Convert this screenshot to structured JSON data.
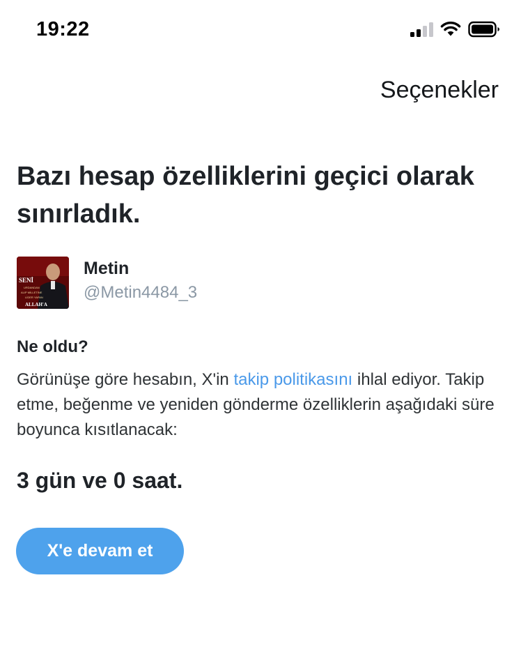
{
  "status_bar": {
    "time": "19:22",
    "icons": [
      "cellular-signal-icon",
      "wifi-icon",
      "battery-icon"
    ]
  },
  "header": {
    "options_label": "Seçenekler"
  },
  "headline": "Bazı hesap özelliklerini geçici olarak sınırladık.",
  "account": {
    "display_name": "Metin",
    "handle": "@Metin4484_3",
    "avatar_text": [
      "SENİ",
      "URDANDAN",
      "ALIP MİLLETİNE",
      "LİDER YAPAN",
      "ALLAH'A"
    ]
  },
  "what_happened": {
    "title": "Ne oldu?",
    "text_before_link": "Görünüşe göre hesabın, X'in ",
    "link_text": "takip politikasını",
    "text_after_link": " ihlal ediyor. Takip etme, beğenme ve yeniden gönderme özelliklerin aşağıdaki süre boyunca kısıtlanacak:"
  },
  "duration": "3 gün ve 0 saat.",
  "continue_button_label": "X'e devam et",
  "colors": {
    "link": "#4a99e9",
    "button": "#4ea2ec",
    "handle": "#8b98a5"
  }
}
